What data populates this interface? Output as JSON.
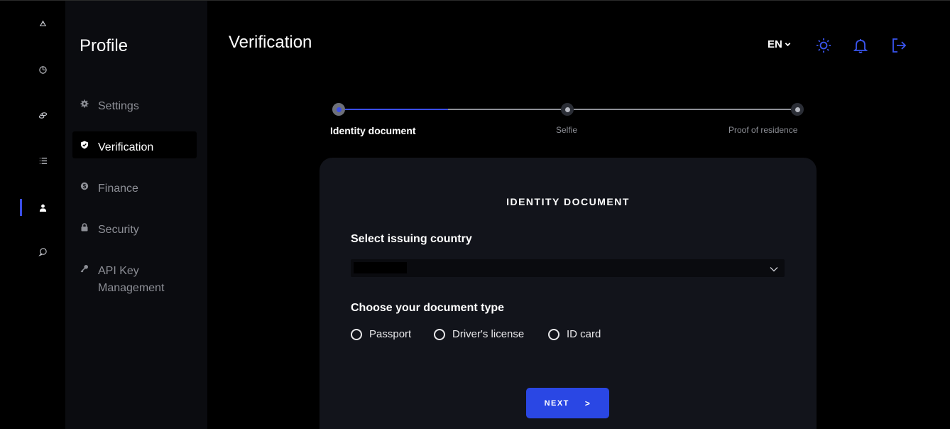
{
  "rail": {
    "items": [
      {
        "icon": "recycle-icon"
      },
      {
        "icon": "pie-chart-icon"
      },
      {
        "icon": "coins-icon"
      },
      {
        "icon": "list-icon"
      },
      {
        "icon": "user-icon",
        "active": true
      },
      {
        "icon": "chat-bubble-icon"
      }
    ]
  },
  "sidebar": {
    "title": "Profile",
    "items": [
      {
        "label": "Settings",
        "icon": "gear-icon"
      },
      {
        "label": "Verification",
        "icon": "shield-check-icon",
        "active": true
      },
      {
        "label": "Finance",
        "icon": "dollar-coin-icon"
      },
      {
        "label": "Security",
        "icon": "lock-icon"
      },
      {
        "label": "API Key Management",
        "icon": "key-icon"
      }
    ]
  },
  "header": {
    "title": "Verification",
    "language": "EN",
    "icons": [
      "sun-icon",
      "bell-icon",
      "logout-icon"
    ]
  },
  "stepper": {
    "steps": [
      {
        "label": "Identity document",
        "active": true
      },
      {
        "label": "Selfie"
      },
      {
        "label": "Proof of residence"
      }
    ]
  },
  "card": {
    "title": "IDENTITY DOCUMENT",
    "country_label": "Select issuing country",
    "country_value": "",
    "doc_type_label": "Choose your document type",
    "doc_types": [
      "Passport",
      "Driver's license",
      "ID card"
    ],
    "next_label": "NEXT",
    "next_arrow": ">"
  },
  "colors": {
    "accent": "#2a47e4",
    "background": "#000000",
    "sidebar_bg": "#0b0c10",
    "card_bg": "#12141b",
    "muted_text": "#8d8f96"
  }
}
